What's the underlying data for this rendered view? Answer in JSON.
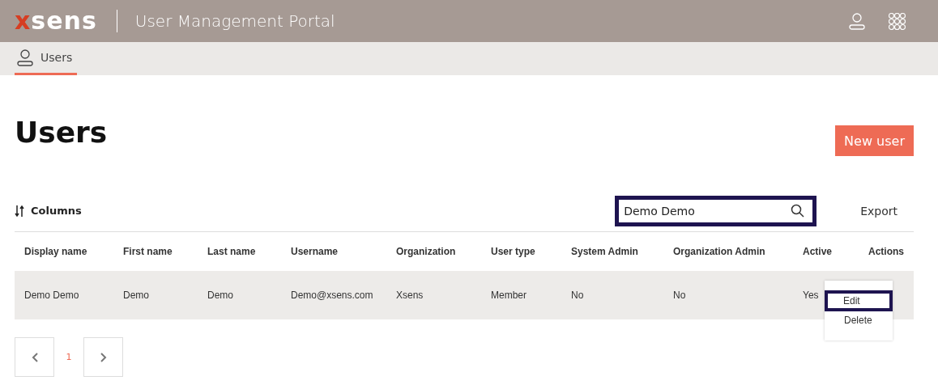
{
  "header": {
    "logo": "xsens",
    "title": "User Management Portal"
  },
  "nav": {
    "tabs": [
      {
        "label": "Users",
        "selected": true
      }
    ]
  },
  "page": {
    "title": "Users",
    "new_button": "New user"
  },
  "toolbar": {
    "columns_button": "Columns",
    "search": {
      "value": "Demo Demo",
      "highlighted": true
    },
    "export_button": "Export"
  },
  "table": {
    "columns": [
      "Display name",
      "First name",
      "Last name",
      "Username",
      "Organization",
      "User type",
      "System Admin",
      "Organization Admin",
      "Active",
      "Actions"
    ],
    "rows": [
      {
        "cells": [
          "Demo Demo",
          "Demo",
          "Demo",
          "Demo@xsens.com",
          "Xsens",
          "Member",
          "No",
          "No",
          "Yes"
        ],
        "menu_open": true
      }
    ]
  },
  "row_menu": {
    "items": [
      {
        "label": "Edit",
        "highlighted": true
      },
      {
        "label": "Delete",
        "highlighted": false
      }
    ]
  },
  "pagination": {
    "pages": [
      {
        "label": "1",
        "selected": true
      }
    ]
  }
}
